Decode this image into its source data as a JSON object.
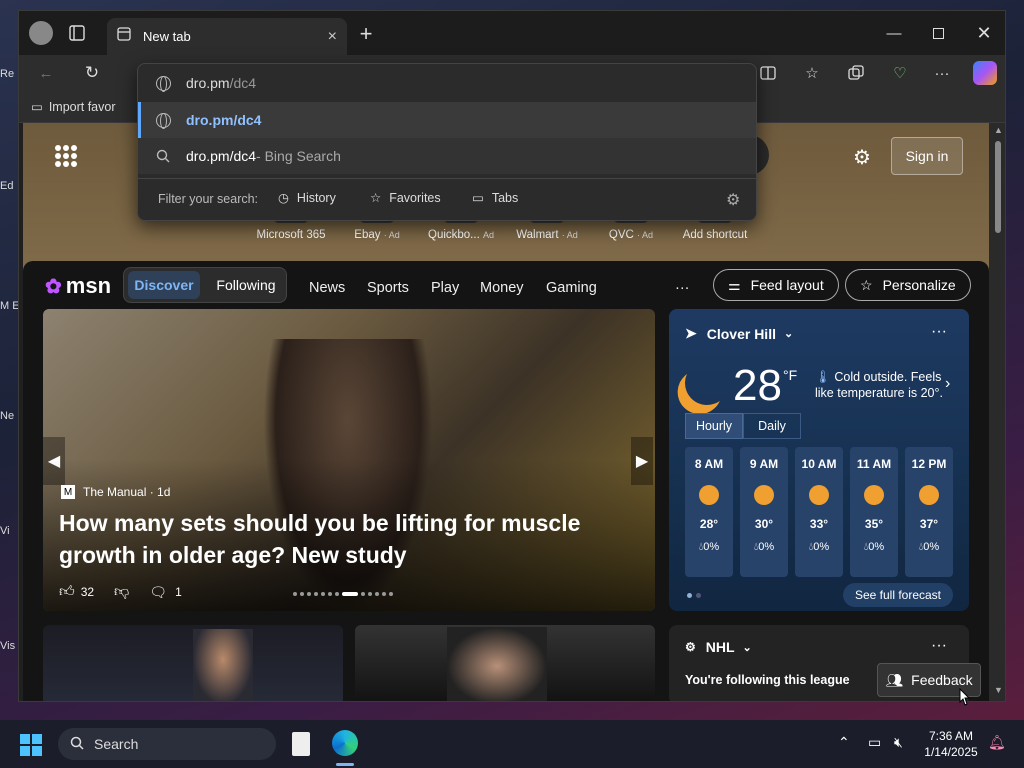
{
  "desktop_labels": [
    "Re",
    "Ed",
    "M E",
    "Ne",
    "Vi",
    "Vis"
  ],
  "browser": {
    "tab_title": "New tab",
    "address": {
      "host": "dro.pm",
      "path": "/dc4"
    },
    "favorites_bar": {
      "import_label": "Import favor"
    },
    "suggestions": [
      {
        "icon": "globe-icon",
        "text": "dro.pm/dc4",
        "suffix": ""
      },
      {
        "icon": "search-icon",
        "text": "dro.pm/dc4",
        "suffix": " - Bing Search"
      }
    ],
    "filter": {
      "label": "Filter your search:",
      "history": "History",
      "favorites": "Favorites",
      "tabs": "Tabs"
    }
  },
  "newtab": {
    "sign_in": "Sign in",
    "shortcuts": [
      {
        "label": "Microsoft 365",
        "ad": ""
      },
      {
        "label": "Ebay",
        "ad": "· Ad"
      },
      {
        "label": "Quickbo...",
        "ad": "Ad"
      },
      {
        "label": "Walmart",
        "ad": "· Ad"
      },
      {
        "label": "QVC",
        "ad": "· Ad"
      },
      {
        "label": "Add shortcut",
        "ad": ""
      }
    ]
  },
  "msn": {
    "logo": "msn",
    "tabs": [
      "Discover",
      "Following"
    ],
    "nav": [
      "News",
      "Sports",
      "Play",
      "Money",
      "Gaming"
    ],
    "more": "···",
    "feed_layout": "Feed layout",
    "personalize": "Personalize",
    "hero": {
      "source": "The Manual",
      "age": "· 1d",
      "headline": "How many sets should you be lifting for muscle growth in older age? New study",
      "likes": "32",
      "comments": "1"
    },
    "weather": {
      "location": "Clover Hill",
      "temp": "28",
      "unit": "°F",
      "description": "Cold outside. Feels like temperature is 20°.",
      "tabs": [
        "Hourly",
        "Daily"
      ],
      "hours": [
        {
          "time": "8 AM",
          "temp": "28°",
          "precip": "0%"
        },
        {
          "time": "9 AM",
          "temp": "30°",
          "precip": "0%"
        },
        {
          "time": "10 AM",
          "temp": "33°",
          "precip": "0%"
        },
        {
          "time": "11 AM",
          "temp": "35°",
          "precip": "0%"
        },
        {
          "time": "12 PM",
          "temp": "37°",
          "precip": "0%"
        }
      ],
      "see_full": "See full forecast"
    },
    "nhl": {
      "title": "NHL",
      "following": "You're following this league"
    },
    "feedback": "Feedback"
  },
  "taskbar": {
    "search": "Search",
    "time": "7:36 AM",
    "date": "1/14/2025"
  }
}
